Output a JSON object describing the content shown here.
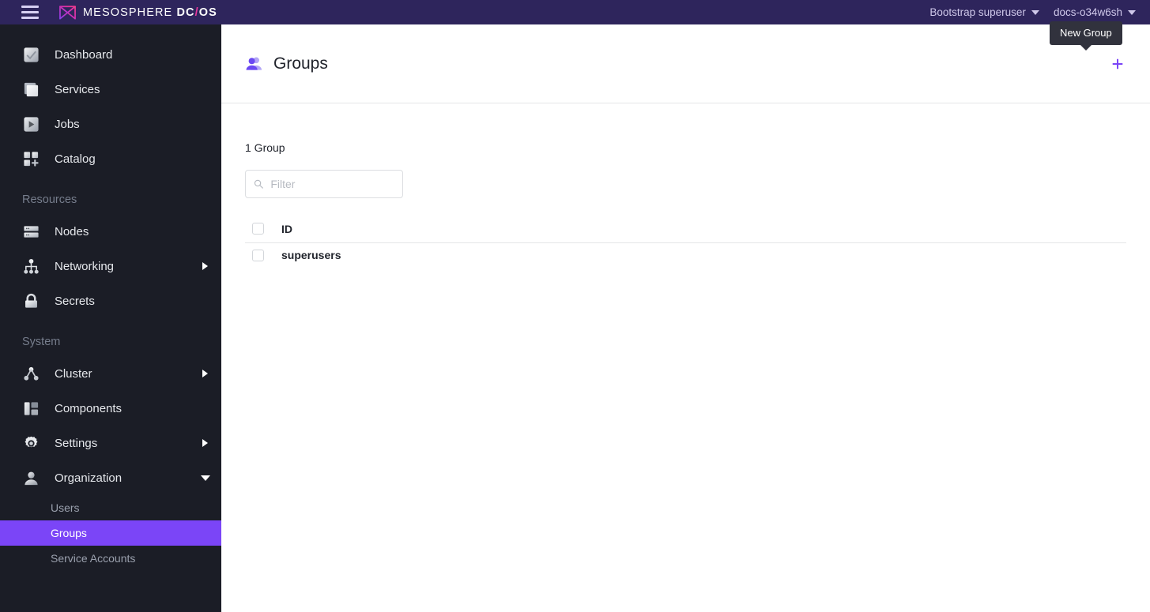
{
  "header": {
    "menu_icon": "hamburger-icon",
    "brand": {
      "logo_icon": "mesosphere-logo-icon",
      "name": "MESOSPHERE",
      "product_dc": "DC",
      "product_slash": "/",
      "product_os": "OS"
    },
    "user_menu": "Bootstrap superuser",
    "cluster_menu": "docs-o34w6sh",
    "colors": {
      "bar": "#2e255c",
      "slash": "#e8379c",
      "text": "#cfc8ea"
    }
  },
  "tooltip": {
    "label": "New Group",
    "background": "#31323d"
  },
  "sidebar": {
    "background": "#1b1d26",
    "active_color": "#7b45f7",
    "primary": [
      {
        "label": "Dashboard",
        "icon": "dashboard-icon",
        "expandable": false
      },
      {
        "label": "Services",
        "icon": "services-icon",
        "expandable": false
      },
      {
        "label": "Jobs",
        "icon": "jobs-icon",
        "expandable": false
      },
      {
        "label": "Catalog",
        "icon": "catalog-icon",
        "expandable": false
      }
    ],
    "resources_label": "Resources",
    "resources": [
      {
        "label": "Nodes",
        "icon": "nodes-icon",
        "expandable": false
      },
      {
        "label": "Networking",
        "icon": "networking-icon",
        "expandable": true,
        "expanded": false
      },
      {
        "label": "Secrets",
        "icon": "secrets-lock-icon",
        "expandable": false
      }
    ],
    "system_label": "System",
    "system": [
      {
        "label": "Cluster",
        "icon": "cluster-icon",
        "expandable": true,
        "expanded": false
      },
      {
        "label": "Components",
        "icon": "components-icon",
        "expandable": false
      },
      {
        "label": "Settings",
        "icon": "settings-gear-icon",
        "expandable": true,
        "expanded": false
      },
      {
        "label": "Organization",
        "icon": "organization-user-icon",
        "expandable": true,
        "expanded": true
      }
    ],
    "organization_children": [
      {
        "label": "Users",
        "active": false
      },
      {
        "label": "Groups",
        "active": true
      },
      {
        "label": "Service Accounts",
        "active": false
      }
    ]
  },
  "page": {
    "title": "Groups",
    "title_icon": "groups-people-icon",
    "new_button_icon": "plus-icon",
    "count_label": "1 Group",
    "filter": {
      "placeholder": "Filter",
      "value": "",
      "icon": "search-icon"
    },
    "table": {
      "columns": [
        "ID"
      ],
      "rows": [
        {
          "id": "superusers",
          "selected": false
        }
      ],
      "select_all": false
    }
  }
}
